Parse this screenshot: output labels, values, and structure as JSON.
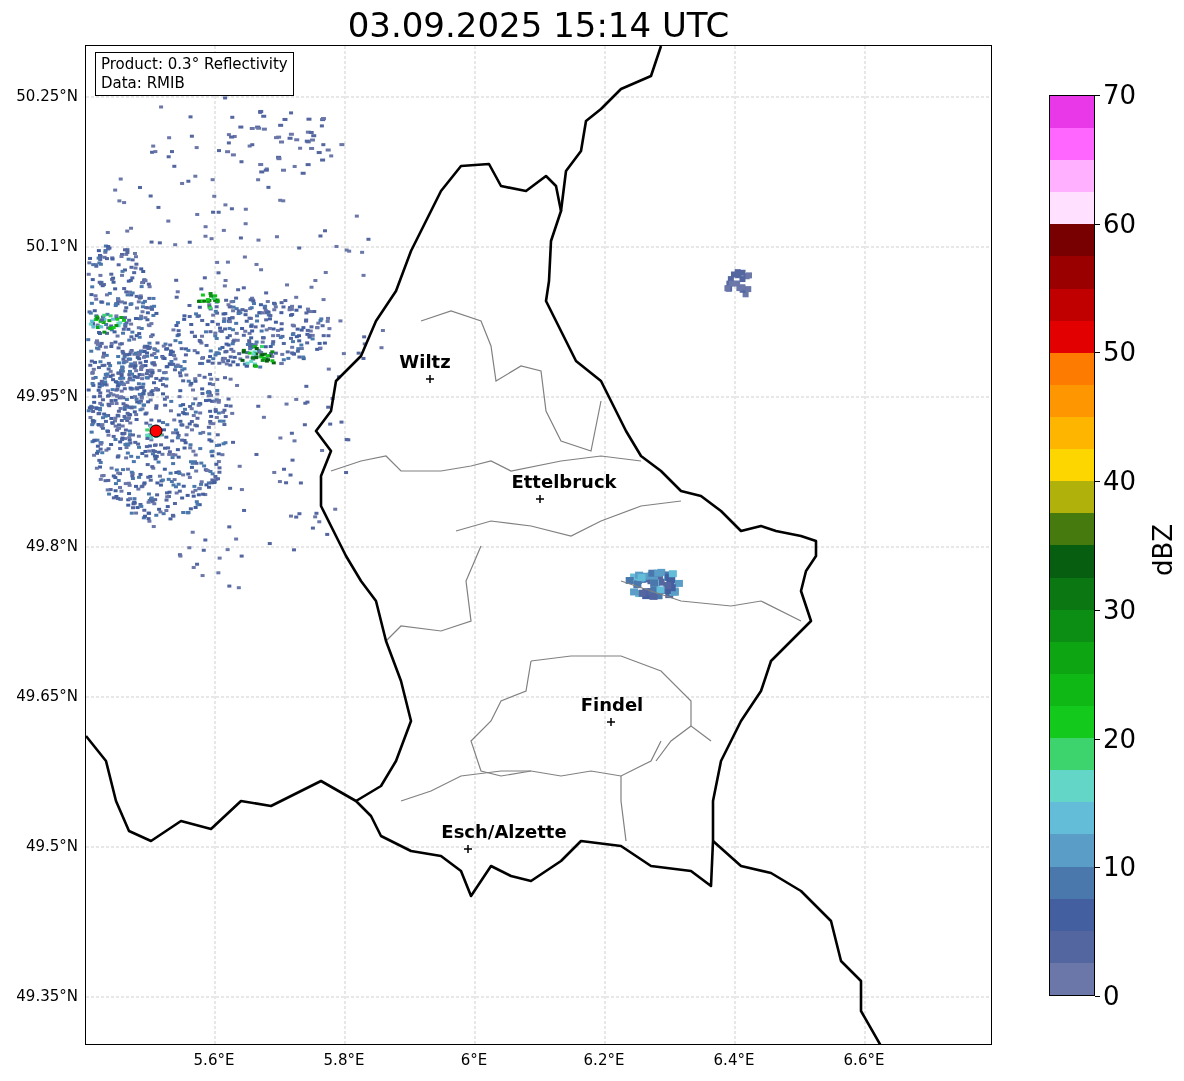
{
  "title": "03.09.2025 15:14 UTC",
  "legend": [
    "Product: 0.3° Reflectivity",
    "Data: RMIB"
  ],
  "cities": [
    "Wiltz",
    "Ettelbruck",
    "Findel",
    "Esch/Alzette"
  ],
  "x_ticks": [
    "5.6°E",
    "5.8°E",
    "6°E",
    "6.2°E",
    "6.4°E",
    "6.6°E"
  ],
  "y_ticks": [
    "50.25°N",
    "50.1°N",
    "49.95°N",
    "49.8°N",
    "49.65°N",
    "49.5°N",
    "49.35°N"
  ],
  "colorbar": {
    "label": "dBZ",
    "ticks": [
      "70",
      "60",
      "50",
      "40",
      "30",
      "20",
      "10",
      "0"
    ]
  }
}
